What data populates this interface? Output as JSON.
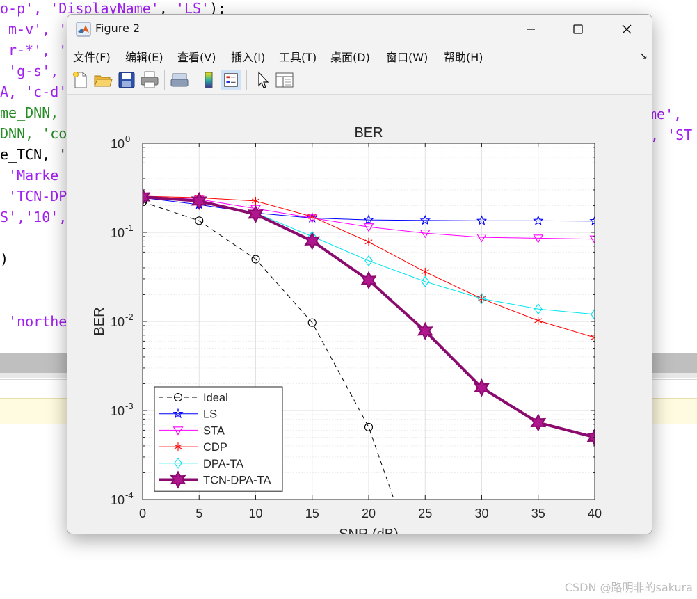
{
  "editor": {
    "left_lines": [
      {
        "text": "o-p', ",
        "cont": [
          {
            "t": "'DisplayName'",
            "c": "#a020f0"
          },
          {
            "t": ", ",
            "c": "#000"
          },
          {
            "t": "'LS'",
            "c": "#a020f0"
          },
          {
            "t": ");",
            "c": "#000"
          }
        ],
        "color": "#a020f0"
      },
      {
        "text": " m-v', '",
        "color": "#a020f0"
      },
      {
        "text": " r-*', '",
        "color": "#a020f0"
      },
      {
        "text": " 'g-s',",
        "color": "#a020f0"
      },
      {
        "text": "A, 'c-d'",
        "color": "#a020f0"
      },
      {
        "text": "me_DNN,",
        "color": "#228b22"
      },
      {
        "text": "DNN, 'co",
        "color": "#228b22"
      },
      {
        "text": "e_TCN, '",
        "color": "#000000"
      },
      {
        "text": " 'Marke",
        "color": "#a020f0"
      },
      {
        "text": " 'TCN-DP",
        "color": "#a020f0"
      },
      {
        "text": "S','10',",
        "color": "#a020f0"
      },
      {
        "text": "",
        "color": "#000"
      },
      {
        "text": ")",
        "color": "#000"
      },
      {
        "text": "",
        "color": "#000"
      },
      {
        "text": "",
        "color": "#000"
      },
      {
        "text": " 'northe",
        "color": "#a020f0"
      }
    ],
    "right_line_1": "me',",
    "right_line_2": ", 'ST"
  },
  "watermark": "CSDN @路明非的sakura",
  "window": {
    "title": "Figure 2",
    "minimize": "—",
    "maximize": "☐",
    "close": "✕"
  },
  "menu": {
    "items": [
      "文件(F)",
      "编辑(E)",
      "查看(V)",
      "插入(I)",
      "工具(T)",
      "桌面(D)",
      "窗口(W)",
      "帮助(H)"
    ],
    "arrow": "↘"
  },
  "toolbar": {
    "buttons": [
      "new-figure-icon",
      "open-icon",
      "save-icon",
      "print-icon",
      "link-icon",
      "colorbar-icon",
      "legend-icon",
      "pointer-icon",
      "property-inspector-icon"
    ]
  },
  "chart_data": {
    "type": "line",
    "title": "BER",
    "xlabel": "SNR (dB)",
    "ylabel": "BER",
    "xlim": [
      0,
      40
    ],
    "ylim_log10": [
      -4,
      0
    ],
    "yscale": "log",
    "x_ticks": [
      0,
      5,
      10,
      15,
      20,
      25,
      30,
      35,
      40
    ],
    "y_tick_labels": [
      {
        "base": "10",
        "exp": "0"
      },
      {
        "base": "10",
        "exp": "-1"
      },
      {
        "base": "10",
        "exp": "-2"
      },
      {
        "base": "10",
        "exp": "-3"
      },
      {
        "base": "10",
        "exp": "-4"
      }
    ],
    "grid": true,
    "legend_position": "bottom-left",
    "series": [
      {
        "name": "Ideal",
        "color": "#000000",
        "marker": "circle",
        "dash": true,
        "width": 1,
        "x": [
          0,
          5,
          10,
          15,
          20,
          25
        ],
        "y": [
          0.22,
          0.135,
          0.05,
          0.0097,
          0.00065,
          1e-05
        ]
      },
      {
        "name": "LS",
        "color": "#0000ff",
        "marker": "pentagram",
        "dash": false,
        "width": 1,
        "x": [
          0,
          5,
          10,
          15,
          20,
          25,
          30,
          35,
          40
        ],
        "y": [
          0.245,
          0.205,
          0.165,
          0.145,
          0.138,
          0.136,
          0.135,
          0.135,
          0.134
        ]
      },
      {
        "name": "STA",
        "color": "#ff00ff",
        "marker": "triangle-down",
        "dash": false,
        "width": 1,
        "x": [
          0,
          5,
          10,
          15,
          20,
          25,
          30,
          35,
          40
        ],
        "y": [
          0.25,
          0.235,
          0.185,
          0.145,
          0.115,
          0.098,
          0.088,
          0.086,
          0.084
        ]
      },
      {
        "name": "CDP",
        "color": "#ff0000",
        "marker": "asterisk",
        "dash": false,
        "width": 1,
        "x": [
          0,
          5,
          10,
          15,
          20,
          25,
          30,
          35,
          40
        ],
        "y": [
          0.255,
          0.245,
          0.225,
          0.15,
          0.078,
          0.036,
          0.018,
          0.0102,
          0.0066
        ]
      },
      {
        "name": "DPA-TA",
        "color": "#00e5ee",
        "marker": "diamond",
        "dash": false,
        "width": 1,
        "x": [
          0,
          5,
          10,
          15,
          20,
          25,
          30,
          35,
          40
        ],
        "y": [
          0.255,
          0.225,
          0.165,
          0.09,
          0.048,
          0.028,
          0.018,
          0.0138,
          0.012
        ]
      },
      {
        "name": "TCN-DPA-TA",
        "color": "#8b0a6e",
        "marker": "hexagram",
        "dash": false,
        "width": 4,
        "x": [
          0,
          5,
          10,
          15,
          20,
          25,
          30,
          35,
          40
        ],
        "y": [
          0.25,
          0.225,
          0.16,
          0.08,
          0.029,
          0.0078,
          0.0018,
          0.00073,
          0.0005
        ]
      }
    ]
  }
}
